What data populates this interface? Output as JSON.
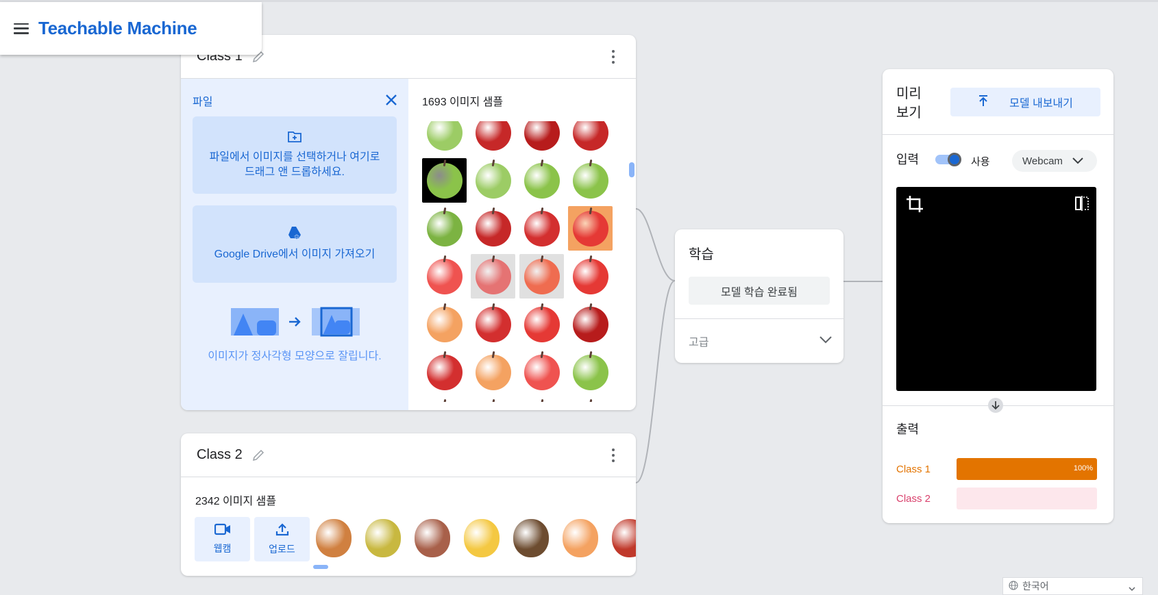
{
  "app": {
    "title": "Teachable Machine"
  },
  "class1": {
    "name": "Class 1",
    "upload_panel": {
      "label": "파일",
      "file_text": "파일에서 이미지를 선택하거나 여기로 드래그 앤 드롭하세요.",
      "drive_text": "Google Drive에서 이미지 가져오기",
      "crop_caption": "이미지가 정사각형 모양으로 잘립니다."
    },
    "sample_count": "1693 이미지 샘플",
    "thumb_colors": [
      "#9ccc65",
      "#c62828",
      "#b71c1c",
      "#c62828",
      "#8bc34a",
      "#9ccc65",
      "#8bc34a",
      "#8bc34a",
      "#7cb342",
      "#c62828",
      "#d32f2f",
      "#e53935",
      "#ef5350",
      "#e57373",
      "#ef6c50",
      "#e53935",
      "#f4a261",
      "#d32f2f",
      "#e53935",
      "#b71c1c",
      "#d32f2f",
      "#f4a261",
      "#ef5350",
      "#8bc34a",
      "#e57373",
      "#f4a261",
      "#7cb342",
      "#ef5350"
    ]
  },
  "class2": {
    "name": "Class 2",
    "sample_count": "2342 이미지 샘플",
    "webcam_label": "웹캠",
    "upload_label": "업로드",
    "thumb_colors": [
      "#d08040",
      "#c8b840",
      "#a8604a",
      "#f4c842",
      "#6d4c30",
      "#f4a261",
      "#c0392b"
    ]
  },
  "training": {
    "title": "학습",
    "button_label": "모델 학습 완료됨",
    "advanced_label": "고급"
  },
  "preview": {
    "title": "미리 보기",
    "export_label": "모델 내보내기",
    "input_label": "입력",
    "use_label": "사용",
    "source_select": "Webcam",
    "output_label": "출력",
    "outputs": [
      {
        "name": "Class 1",
        "color": "#e37400",
        "bg": "#fde3c8",
        "confidence": 1.0,
        "pct_label": "100%"
      },
      {
        "name": "Class 2",
        "color": "#d93f6b",
        "bg": "#fde7ec",
        "confidence": 0.0,
        "pct_label": ""
      }
    ]
  },
  "language": {
    "selected": "한국어"
  }
}
